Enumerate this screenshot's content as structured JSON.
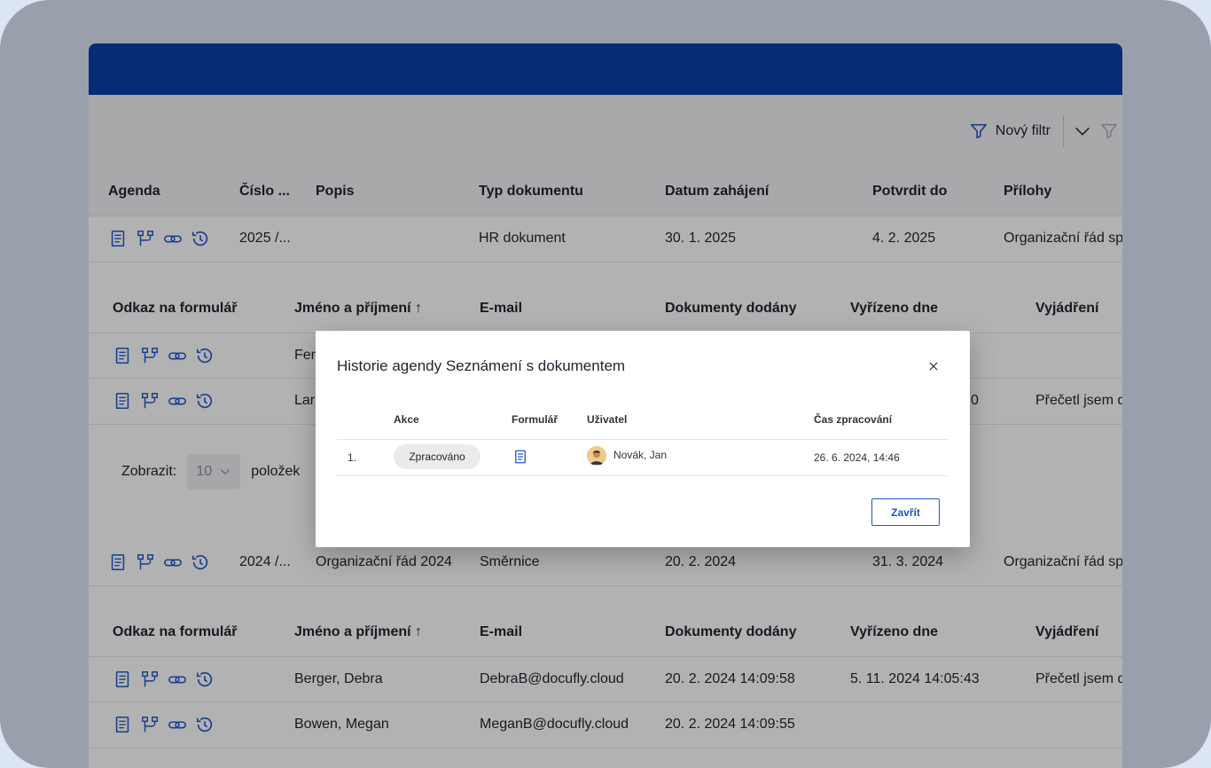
{
  "filter": {
    "new_filter_label": "Nový filtr"
  },
  "main_table": {
    "headers": [
      "Agenda",
      "Číslo ...",
      "Popis",
      "Typ dokumentu",
      "Datum zahájení",
      "Potvrdit do",
      "Přílohy"
    ],
    "rows": [
      {
        "cislo": "2025 /...",
        "popis": "",
        "typ": "HR dokument",
        "datum": "30. 1. 2025",
        "potvrdit": "4. 2. 2025",
        "prilohy": "Organizační řád sp"
      },
      {
        "cislo": "2024 /...",
        "popis": "Organizační řád 2024",
        "typ": "Směrnice",
        "datum": "20. 2. 2024",
        "potvrdit": "31. 3. 2024",
        "prilohy": "Organizační řád sp"
      }
    ]
  },
  "sub_table_1": {
    "headers": [
      "Odkaz na formulář",
      "Jméno a příjmení",
      "E-mail",
      "Dokumenty dodány",
      "Vyřízeno dne",
      "Vyjádření"
    ],
    "rows": [
      {
        "jmeno": "Fer",
        "email": "",
        "dodany": "",
        "vyrizeno": "",
        "vyjadreni": ""
      },
      {
        "jmeno": "Lar",
        "email": "",
        "dodany": "",
        "vyrizeno": "0",
        "vyjadreni": "Přečetl jsem d"
      }
    ]
  },
  "pager": {
    "show_label": "Zobrazit:",
    "page_size": "10",
    "items_label": "položek"
  },
  "sub_table_2": {
    "headers": [
      "Odkaz na formulář",
      "Jméno a příjmení",
      "E-mail",
      "Dokumenty dodány",
      "Vyřízeno dne",
      "Vyjádření"
    ],
    "rows": [
      {
        "jmeno": "Berger, Debra",
        "email": "DebraB@docufly.cloud",
        "dodany": "20. 2. 2024 14:09:58",
        "vyrizeno": "5. 11. 2024 14:05:43",
        "vyjadreni": "Přečetl jsem d"
      },
      {
        "jmeno": "Bowen, Megan",
        "email": "MeganB@docufly.cloud",
        "dodany": "20. 2. 2024 14:09:55",
        "vyrizeno": "",
        "vyjadreni": ""
      }
    ]
  },
  "modal": {
    "title": "Historie agendy Seznámení s dokumentem",
    "close_icon": "close-icon",
    "headers": {
      "akce": "Akce",
      "formular": "Formulář",
      "uzivatel": "Uživatel",
      "cas": "Čas zpracování"
    },
    "row": {
      "index": "1.",
      "akce": "Zpracováno",
      "uzivatel": "Novák, Jan",
      "cas": "26. 6. 2024, 14:46"
    },
    "close_button": "Zavřít"
  },
  "colors": {
    "topbar": "#0a3fa8",
    "accent": "#2459c9",
    "overlay": "rgba(0,0,0,0.30)"
  }
}
